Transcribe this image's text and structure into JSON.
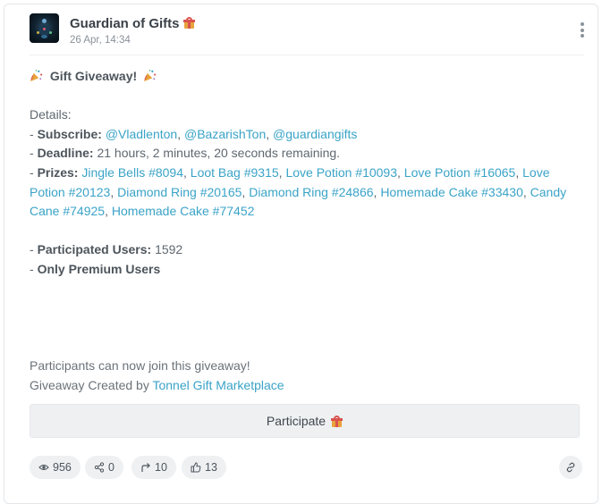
{
  "post": {
    "channel_name": "Guardian of Gifts",
    "timestamp": "26 Apr, 14:34",
    "title": "Gift Giveaway!",
    "details_label": "Details:",
    "subscribe_label": "Subscribe:",
    "subscribe_accounts": [
      "@Vladlenton",
      "@BazarishTon",
      "@guardiangifts"
    ],
    "deadline_label": "Deadline:",
    "deadline_value": "21 hours, 2 minutes, 20 seconds remaining.",
    "prizes_label": "Prizes:",
    "prizes": [
      "Jingle Bells #8094",
      "Loot Bag #9315",
      "Love Potion #10093",
      "Love Potion #16065",
      "Love Potion #20123",
      "Diamond Ring #20165",
      "Diamond Ring #24866",
      "Homemade Cake #33430",
      "Candy Cane #74925",
      "Homemade Cake #77452"
    ],
    "participated_label": "Participated Users:",
    "participated_value": "1592",
    "premium_label": "Only Premium Users",
    "join_text": "Participants can now join this giveaway!",
    "created_by_prefix": "Giveaway Created by",
    "created_by_link": "Tonnel Gift Marketplace"
  },
  "actions": {
    "participate_label": "Participate"
  },
  "stats": {
    "views": "956",
    "shares": "0",
    "forwards": "10",
    "likes": "13"
  },
  "icons": {
    "menu": "kebab-menu-icon",
    "gift": "gift-icon",
    "party": "party-popper-icon",
    "views": "eye-icon",
    "shares": "share-nodes-icon",
    "forwards": "forward-arrow-icon",
    "likes": "thumbs-up-icon",
    "link": "link-icon"
  },
  "colors": {
    "link": "#3aa3c7",
    "button_bg": "#eef0f2"
  }
}
